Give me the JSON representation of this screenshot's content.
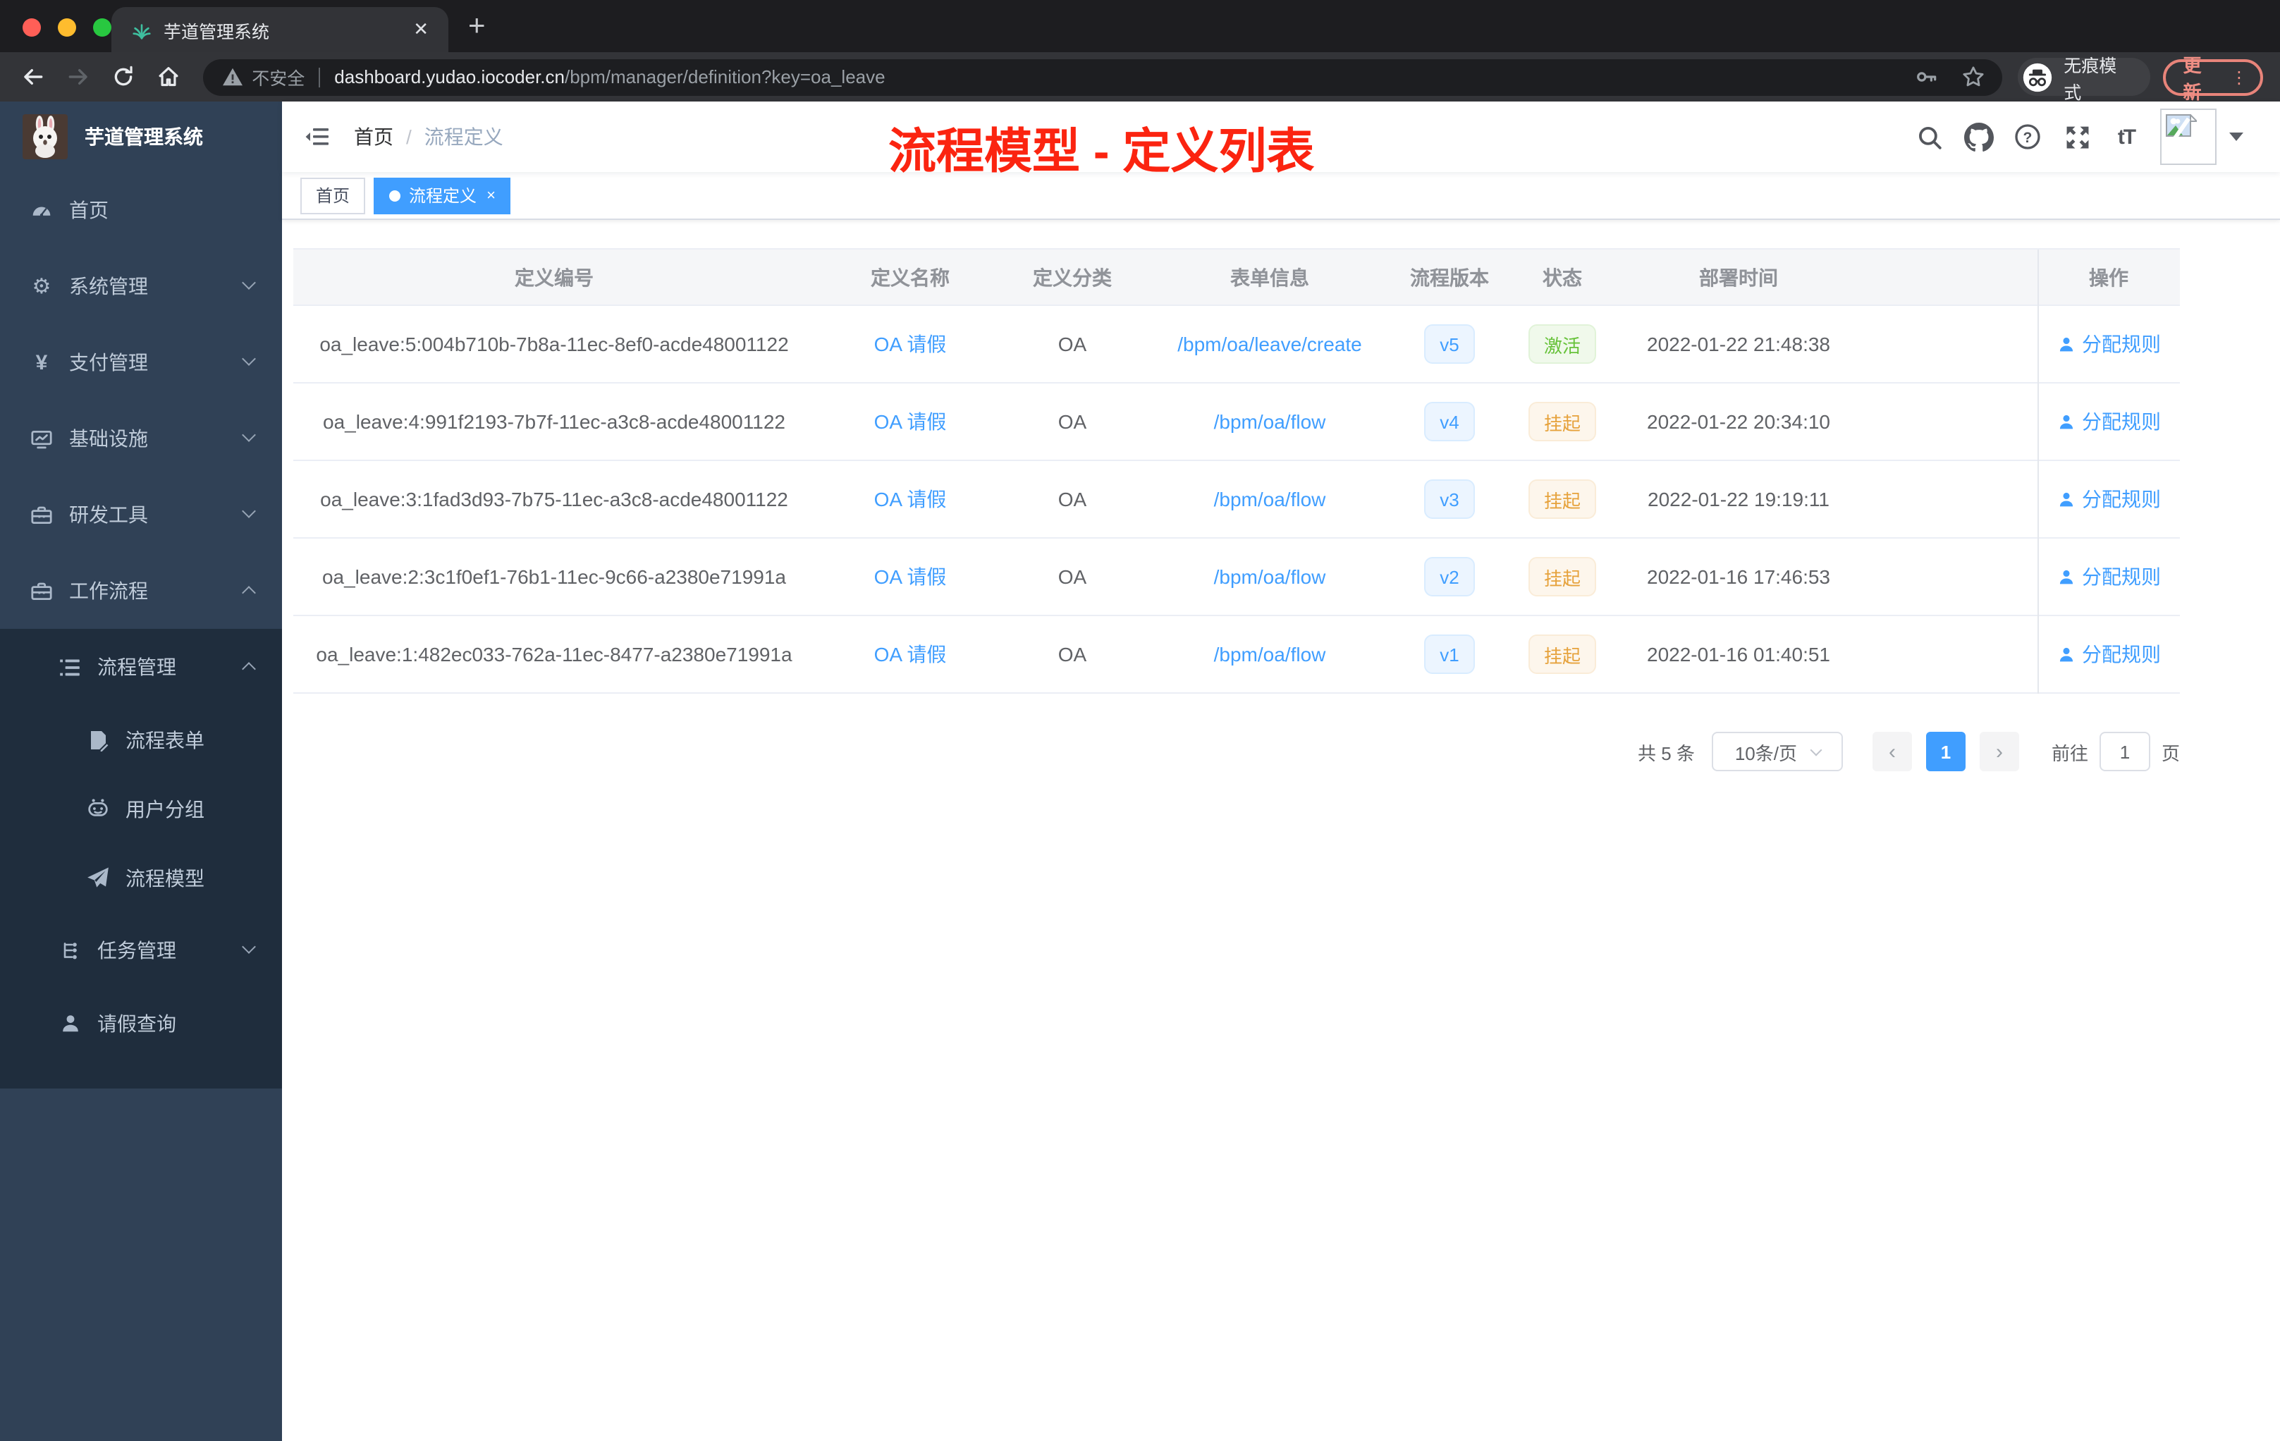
{
  "browser": {
    "tab_title": "芋道管理系统",
    "tab_close": "✕",
    "new_tab": "+",
    "security": "不安全",
    "host": "dashboard.yudao.iocoder.cn",
    "path": "/bpm/manager/definition?key=oa_leave",
    "incognito": "无痕模式",
    "update": "更新",
    "menu_dots": "⋮"
  },
  "sidebar": {
    "title": "芋道管理系统",
    "items": [
      {
        "label": "首页",
        "icon": "dashboard-icon"
      },
      {
        "label": "系统管理",
        "icon": "gear-icon",
        "chevron": "down"
      },
      {
        "label": "支付管理",
        "icon": "yen-icon",
        "chevron": "down"
      },
      {
        "label": "基础设施",
        "icon": "monitor-icon",
        "chevron": "down"
      },
      {
        "label": "研发工具",
        "icon": "toolbox-icon",
        "chevron": "down"
      },
      {
        "label": "工作流程",
        "icon": "briefcase-icon",
        "chevron": "up"
      },
      {
        "label": "流程管理",
        "icon": "list-icon",
        "chevron": "up"
      },
      {
        "label": "流程表单",
        "icon": "form-icon"
      },
      {
        "label": "用户分组",
        "icon": "robot-icon"
      },
      {
        "label": "流程模型",
        "icon": "send-icon"
      },
      {
        "label": "任务管理",
        "icon": "tree-icon",
        "chevron": "down"
      },
      {
        "label": "请假查询",
        "icon": "user-icon"
      }
    ]
  },
  "header": {
    "breadcrumb_home": "首页",
    "breadcrumb_sep": "/",
    "breadcrumb_current": "流程定义",
    "annotation": "流程模型 - 定义列表",
    "font_icon_text": "tT"
  },
  "tags": [
    {
      "label": "首页",
      "active": false
    },
    {
      "label": "流程定义",
      "active": true,
      "close": "×"
    }
  ],
  "table": {
    "columns": [
      "定义编号",
      "定义名称",
      "定义分类",
      "表单信息",
      "流程版本",
      "状态",
      "部署时间",
      "操作"
    ],
    "rows": [
      {
        "id": "oa_leave:5:004b710b-7b8a-11ec-8ef0-acde48001122",
        "name": "OA 请假",
        "category": "OA",
        "form": "/bpm/oa/leave/create",
        "version": "v5",
        "status": "激活",
        "status_class": "tag tag-success",
        "time": "2022-01-22 21:48:38",
        "action": "分配规则"
      },
      {
        "id": "oa_leave:4:991f2193-7b7f-11ec-a3c8-acde48001122",
        "name": "OA 请假",
        "category": "OA",
        "form": "/bpm/oa/flow",
        "version": "v4",
        "status": "挂起",
        "status_class": "tag tag-warning",
        "time": "2022-01-22 20:34:10",
        "action": "分配规则"
      },
      {
        "id": "oa_leave:3:1fad3d93-7b75-11ec-a3c8-acde48001122",
        "name": "OA 请假",
        "category": "OA",
        "form": "/bpm/oa/flow",
        "version": "v3",
        "status": "挂起",
        "status_class": "tag tag-warning",
        "time": "2022-01-22 19:19:11",
        "action": "分配规则"
      },
      {
        "id": "oa_leave:2:3c1f0ef1-76b1-11ec-9c66-a2380e71991a",
        "name": "OA 请假",
        "category": "OA",
        "form": "/bpm/oa/flow",
        "version": "v2",
        "status": "挂起",
        "status_class": "tag tag-warning",
        "time": "2022-01-16 17:46:53",
        "action": "分配规则"
      },
      {
        "id": "oa_leave:1:482ec033-762a-11ec-8477-a2380e71991a",
        "name": "OA 请假",
        "category": "OA",
        "form": "/bpm/oa/flow",
        "version": "v1",
        "status": "挂起",
        "status_class": "tag tag-warning",
        "time": "2022-01-16 01:40:51",
        "action": "分配规则"
      }
    ]
  },
  "pagination": {
    "total": "共 5 条",
    "page_size": "10条/页",
    "prev": "‹",
    "current": "1",
    "next": "›",
    "goto_label": "前往",
    "goto_value": "1",
    "page_label": "页"
  },
  "colors": {
    "accent_blue": "#409eff",
    "success_green": "#67c23a",
    "warning_orange": "#e6a23c",
    "annotation_red": "#fb2410",
    "sidebar_bg": "#304156",
    "submenu_bg": "#1f2d3d"
  }
}
